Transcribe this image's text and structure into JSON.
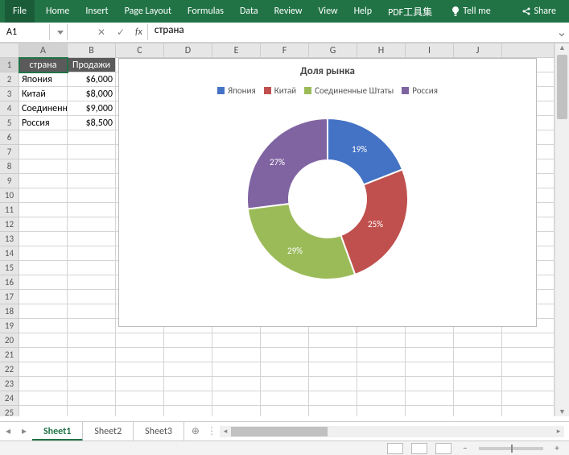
{
  "ribbon": {
    "file": "File",
    "tabs": [
      "Home",
      "Insert",
      "Page Layout",
      "Formulas",
      "Data",
      "Review",
      "View",
      "Help",
      "PDF工具集"
    ],
    "tellme": "Tell me",
    "share": "Share"
  },
  "namebox": {
    "ref": "A1"
  },
  "formula": {
    "value": "страна"
  },
  "columns": [
    "A",
    "B",
    "C",
    "D",
    "E",
    "F",
    "G",
    "H",
    "I",
    "J"
  ],
  "rows": 25,
  "data": {
    "headers": [
      "страна",
      "Продажи"
    ],
    "rows": [
      {
        "country": "Япония",
        "sales": "$6,000"
      },
      {
        "country": "Китай",
        "sales": "$8,000"
      },
      {
        "country": "Соединенные Штаты",
        "sales": "$9,000"
      },
      {
        "country": "Россия",
        "sales": "$8,500"
      }
    ]
  },
  "sheets": {
    "tabs": [
      "Sheet1",
      "Sheet2",
      "Sheet3"
    ],
    "active": 0
  },
  "chart_data": {
    "type": "pie",
    "title": "Доля рынка",
    "categories": [
      "Япония",
      "Китай",
      "Соединенные Штаты",
      "Россия"
    ],
    "values": [
      6000,
      8000,
      9000,
      8500
    ],
    "percent_labels": [
      "19%",
      "25%",
      "29%",
      "27%"
    ],
    "colors": [
      "#4472C4",
      "#C0504D",
      "#9BBB59",
      "#8064A2"
    ],
    "legend_position": "top",
    "donut": true
  }
}
